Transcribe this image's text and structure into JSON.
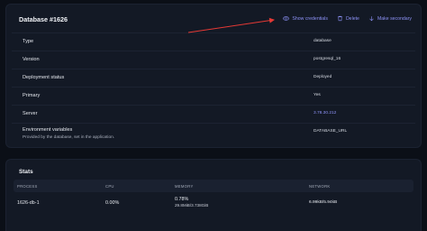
{
  "database": {
    "title": "Database #1626",
    "actions": {
      "show_credentials": "Show credentials",
      "delete": "Delete",
      "make_secondary": "Make secondary"
    },
    "rows": [
      {
        "label": "Type",
        "value": "database"
      },
      {
        "label": "Version",
        "value": "postgresql_16"
      },
      {
        "label": "Deployment status",
        "value": "Deployed"
      },
      {
        "label": "Primary",
        "value": "Yes"
      },
      {
        "label": "Server",
        "value": "3.78.30.212"
      },
      {
        "label": "Environment variables",
        "sublabel": "Provided by the database, set in the application.",
        "value": "DATABASE_URL"
      }
    ]
  },
  "stats": {
    "title": "Stats",
    "headers": {
      "process": "PROCESS",
      "cpu": "CPU",
      "memory": "MEMORY",
      "network": "NETWORK"
    },
    "row": {
      "process": "1626-db-1",
      "cpu": "0.00%",
      "memory_pct": "0.78%",
      "memory_abs": "29.8MiB/3.738GiB",
      "network": "6.99kB/5.94kB"
    }
  },
  "colors": {
    "background": "#0b0f17",
    "card": "#131925",
    "accent": "#8c91f5",
    "annotation_arrow": "#e53935"
  },
  "icons": {
    "show_credentials": "eye-icon",
    "delete": "trash-icon",
    "make_secondary": "arrow-down-icon"
  }
}
